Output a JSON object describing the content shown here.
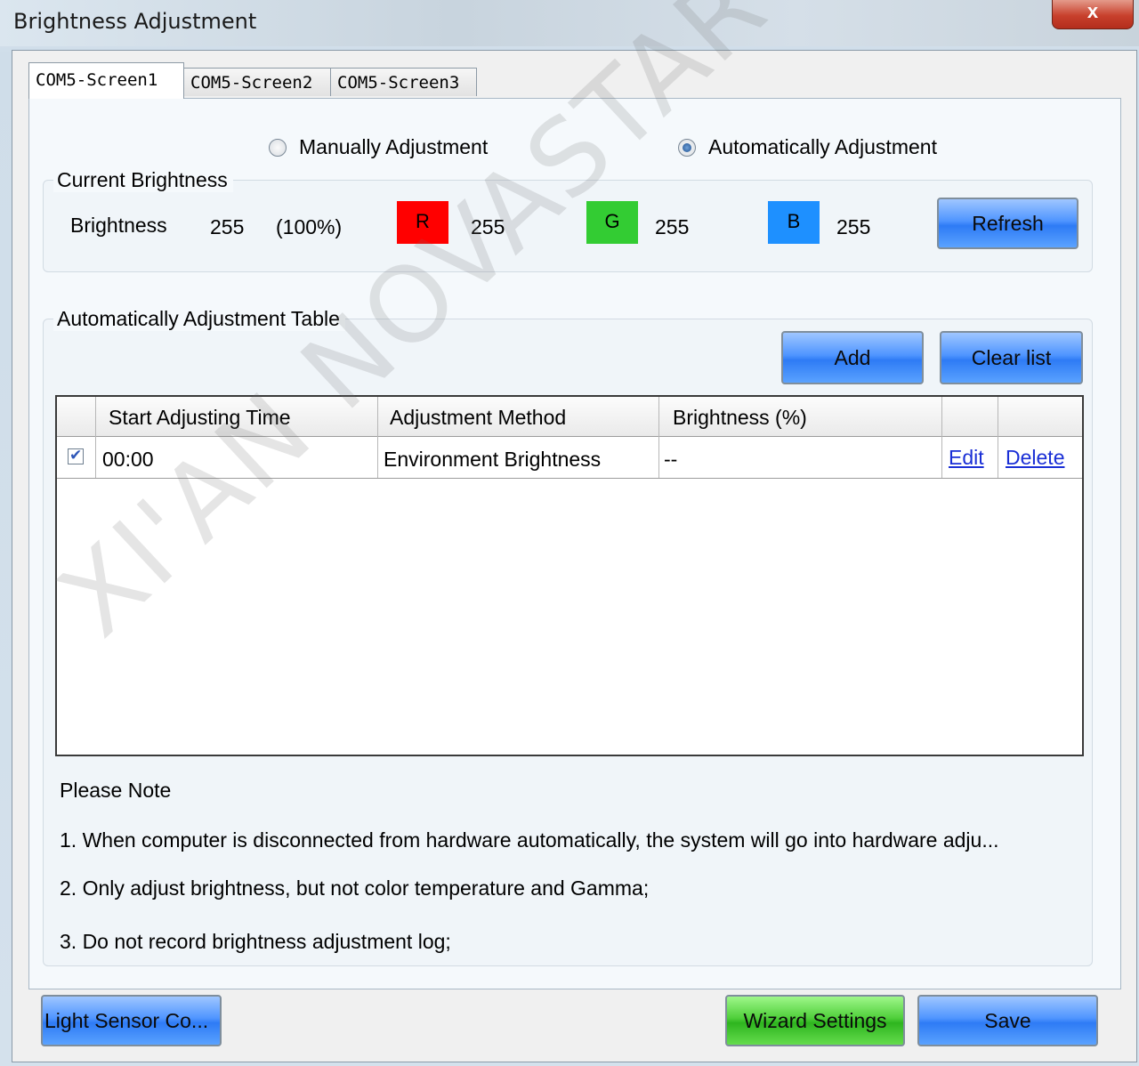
{
  "window": {
    "title": "Brightness Adjustment",
    "close_glyph": "x"
  },
  "tabs": [
    {
      "label": "COM5-Screen1",
      "active": true
    },
    {
      "label": "COM5-Screen2",
      "active": false
    },
    {
      "label": "COM5-Screen3",
      "active": false
    }
  ],
  "mode": {
    "manual_label": "Manually Adjustment",
    "auto_label": "Automatically Adjustment",
    "selected": "auto"
  },
  "current": {
    "group_title": "Current Brightness",
    "brightness_label": "Brightness",
    "brightness_value": "255",
    "brightness_percent": "(100%)",
    "r_label": "R",
    "r_value": "255",
    "r_color": "#ff0000",
    "g_label": "G",
    "g_value": "255",
    "g_color": "#33cc33",
    "b_label": "B",
    "b_value": "255",
    "b_color": "#1e90ff",
    "refresh_label": "Refresh"
  },
  "table": {
    "group_title": "Automatically Adjustment Table",
    "add_label": "Add",
    "clear_label": "Clear list",
    "columns": [
      "Start Adjusting Time",
      "Adjustment Method",
      "Brightness (%)"
    ],
    "rows": [
      {
        "checked": true,
        "time": "00:00",
        "method": "Environment Brightness",
        "brightness": "--",
        "edit": "Edit",
        "delete": "Delete"
      }
    ]
  },
  "notes": {
    "title": "Please Note",
    "items": [
      "1. When computer is disconnected from hardware automatically, the system will go into hardware adju...",
      "2. Only adjust brightness, but not color temperature and Gamma;",
      "3. Do not record brightness adjustment log;"
    ]
  },
  "footer": {
    "light_sensor_label": "Light Sensor Co...",
    "wizard_label": "Wizard Settings",
    "save_label": "Save"
  },
  "watermark": "XI'AN NOVASTAR TECH CO., LT"
}
